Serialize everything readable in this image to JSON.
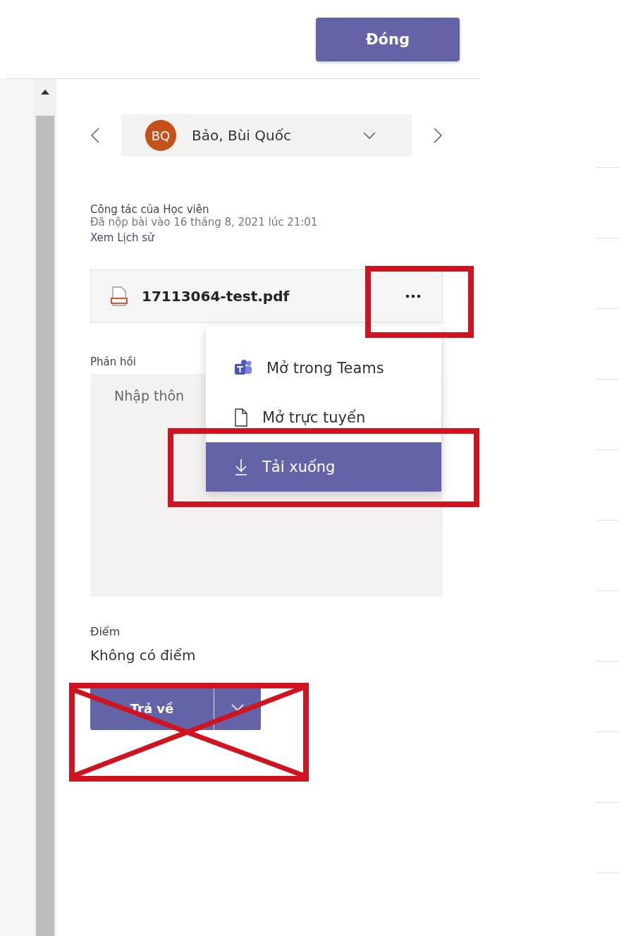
{
  "header": {
    "close_button": "Đóng"
  },
  "student_nav": {
    "avatar_initials": "BQ",
    "name": "Bảo, Bùi Quốc"
  },
  "submission": {
    "title": "Công tác của Học viên",
    "submitted": "Đã nộp bài vào 16 tháng 8, 2021 lúc 21:01",
    "history_link": "Xem Lịch sử"
  },
  "file": {
    "name": "17113064-test.pdf"
  },
  "file_menu": [
    {
      "kind": "teams",
      "label": "Mở trong Teams",
      "selected": false
    },
    {
      "kind": "online",
      "label": "Mở trực tuyến",
      "selected": false
    },
    {
      "kind": "download",
      "label": "Tải xuống",
      "selected": true
    }
  ],
  "feedback": {
    "label": "Phản hồi",
    "placeholder": "Nhập thôn"
  },
  "grade": {
    "label": "Điểm",
    "value": "Không có điểm"
  },
  "return_button": {
    "label": "Trả về"
  },
  "annotations": [
    {
      "kind": "box"
    },
    {
      "kind": "box"
    },
    {
      "kind": "cross"
    }
  ]
}
